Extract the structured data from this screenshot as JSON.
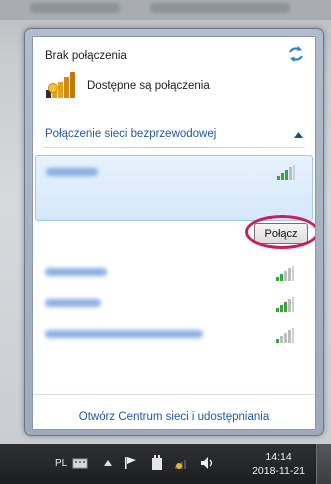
{
  "flyout": {
    "status_title": "Brak połączenia",
    "available_label": "Dostępne są połączenia",
    "section_header": "Połączenie sieci bezprzewodowej",
    "connect_label": "Połącz",
    "footer_link": "Otwórz Centrum sieci i udostępniania",
    "icons": {
      "refresh": "refresh-arrows-icon",
      "available": "network-bars-star-icon",
      "collapse": "chevron-up-icon",
      "signal": "wifi-signal-bars-icon"
    },
    "networks": [
      {
        "name": "",
        "selected": true
      },
      {
        "name": "",
        "selected": false
      },
      {
        "name": "",
        "selected": false
      },
      {
        "name": "",
        "selected": false
      }
    ]
  },
  "taskbar": {
    "language": "PL",
    "time": "14:14",
    "date": "2018-11-21",
    "icons": [
      "keyboard-icon",
      "show-hidden-icon",
      "action-center-flag-icon",
      "power-icon",
      "network-icon",
      "volume-icon"
    ]
  },
  "colors": {
    "link": "#1f5aa0",
    "selection_fill": "#d4e7fa",
    "highlight_circle": "#c81e5a",
    "signal_green": "#3aa23a"
  }
}
